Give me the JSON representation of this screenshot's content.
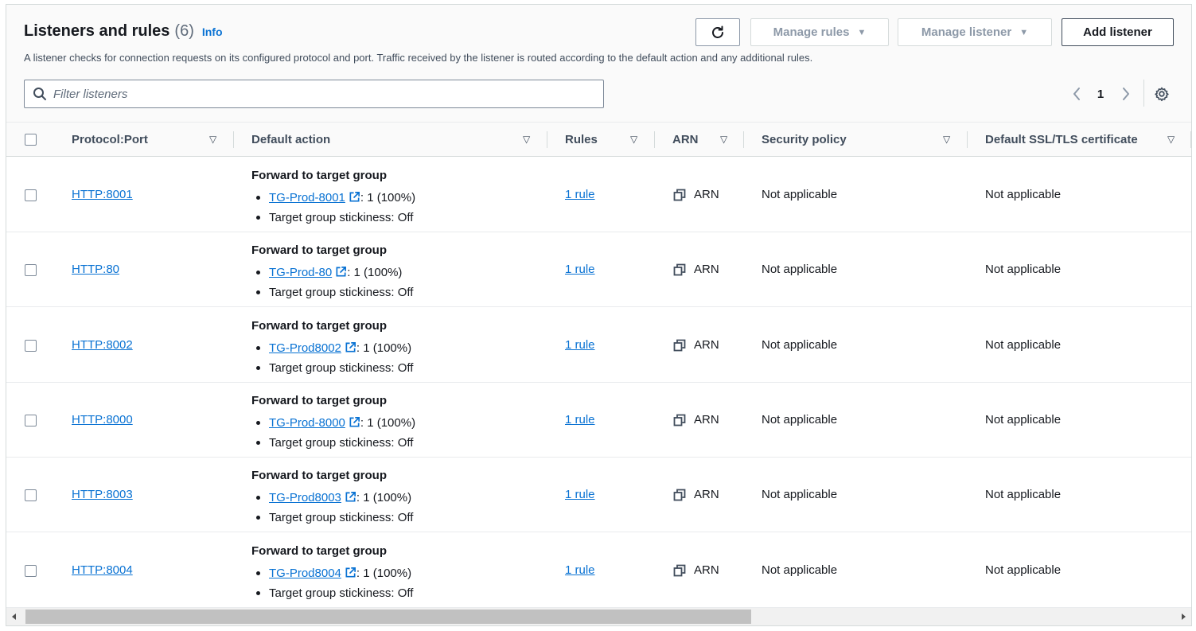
{
  "header": {
    "title": "Listeners and rules",
    "count": "(6)",
    "info": "Info",
    "description": "A listener checks for connection requests on its configured protocol and port. Traffic received by the listener is routed according to the default action and any additional rules."
  },
  "buttons": {
    "refresh_icon": "refresh-icon",
    "manage_rules": "Manage rules",
    "manage_listener": "Manage listener",
    "add_listener": "Add listener"
  },
  "filter": {
    "placeholder": "Filter listeners"
  },
  "pagination": {
    "page": "1"
  },
  "columns": {
    "protocol_port": "Protocol:Port",
    "default_action": "Default action",
    "rules": "Rules",
    "arn": "ARN",
    "security_policy": "Security policy",
    "ssl_cert": "Default SSL/TLS certificate"
  },
  "rows": [
    {
      "protocol_port": "HTTP:8001",
      "action_title": "Forward to target group",
      "target_group": "TG-Prod-8001",
      "weight": ": 1 (100%)",
      "stickiness": "Target group stickiness: Off",
      "rules": "1 rule",
      "arn": "ARN",
      "security_policy": "Not applicable",
      "ssl_cert": "Not applicable"
    },
    {
      "protocol_port": "HTTP:80",
      "action_title": "Forward to target group",
      "target_group": "TG-Prod-80",
      "weight": ": 1 (100%)",
      "stickiness": "Target group stickiness: Off",
      "rules": "1 rule",
      "arn": "ARN",
      "security_policy": "Not applicable",
      "ssl_cert": "Not applicable"
    },
    {
      "protocol_port": "HTTP:8002",
      "action_title": "Forward to target group",
      "target_group": "TG-Prod8002",
      "weight": ": 1 (100%)",
      "stickiness": "Target group stickiness: Off",
      "rules": "1 rule",
      "arn": "ARN",
      "security_policy": "Not applicable",
      "ssl_cert": "Not applicable"
    },
    {
      "protocol_port": "HTTP:8000",
      "action_title": "Forward to target group",
      "target_group": "TG-Prod-8000",
      "weight": ": 1 (100%)",
      "stickiness": "Target group stickiness: Off",
      "rules": "1 rule",
      "arn": "ARN",
      "security_policy": "Not applicable",
      "ssl_cert": "Not applicable"
    },
    {
      "protocol_port": "HTTP:8003",
      "action_title": "Forward to target group",
      "target_group": "TG-Prod8003",
      "weight": ": 1 (100%)",
      "stickiness": "Target group stickiness: Off",
      "rules": "1 rule",
      "arn": "ARN",
      "security_policy": "Not applicable",
      "ssl_cert": "Not applicable"
    },
    {
      "protocol_port": "HTTP:8004",
      "action_title": "Forward to target group",
      "target_group": "TG-Prod8004",
      "weight": ": 1 (100%)",
      "stickiness": "Target group stickiness: Off",
      "rules": "1 rule",
      "arn": "ARN",
      "security_policy": "Not applicable",
      "ssl_cert": "Not applicable"
    }
  ],
  "colors": {
    "link": "#0972d3",
    "text": "#16191f",
    "muted": "#5f6b7a",
    "border": "#d5dbdb"
  }
}
